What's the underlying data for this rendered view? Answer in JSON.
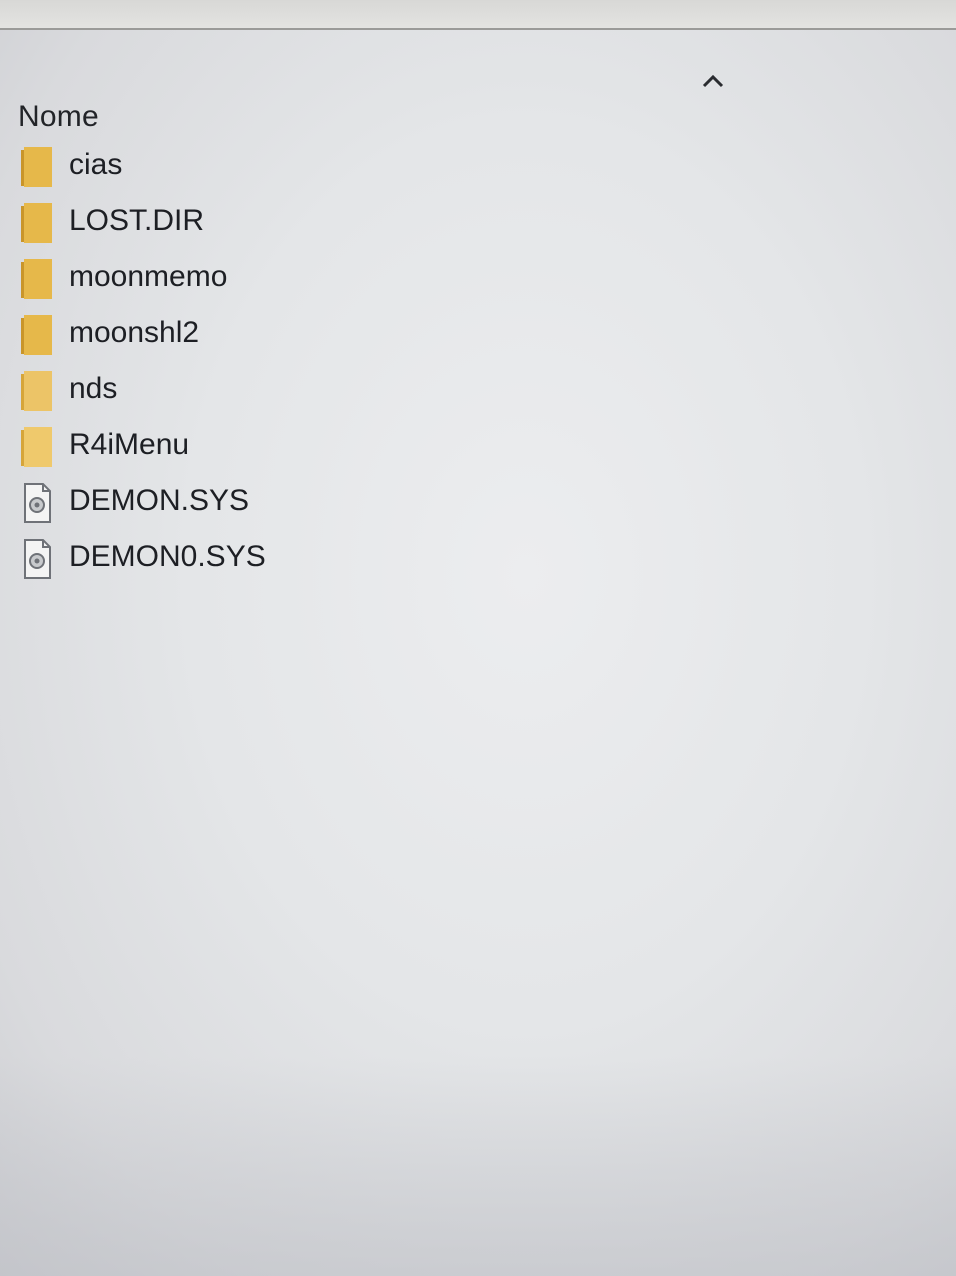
{
  "header": {
    "column_name": "Nome",
    "sort_icon": "chevron-up-icon"
  },
  "files": [
    {
      "name": "cias",
      "type": "folder",
      "icon": "folder-icon"
    },
    {
      "name": "LOST.DIR",
      "type": "folder",
      "icon": "folder-icon"
    },
    {
      "name": "moonmemo",
      "type": "folder",
      "icon": "folder-icon"
    },
    {
      "name": "moonshl2",
      "type": "folder",
      "icon": "folder-icon"
    },
    {
      "name": "nds",
      "type": "folder",
      "icon": "folder-icon"
    },
    {
      "name": "R4iMenu",
      "type": "folder",
      "icon": "folder-icon"
    },
    {
      "name": "DEMON.SYS",
      "type": "file",
      "icon": "system-file-icon"
    },
    {
      "name": "DEMON0.SYS",
      "type": "file",
      "icon": "system-file-icon"
    }
  ],
  "colors": {
    "folder": "#e6b84a",
    "folder_dark": "#c9952a",
    "text": "#1d1f24"
  }
}
